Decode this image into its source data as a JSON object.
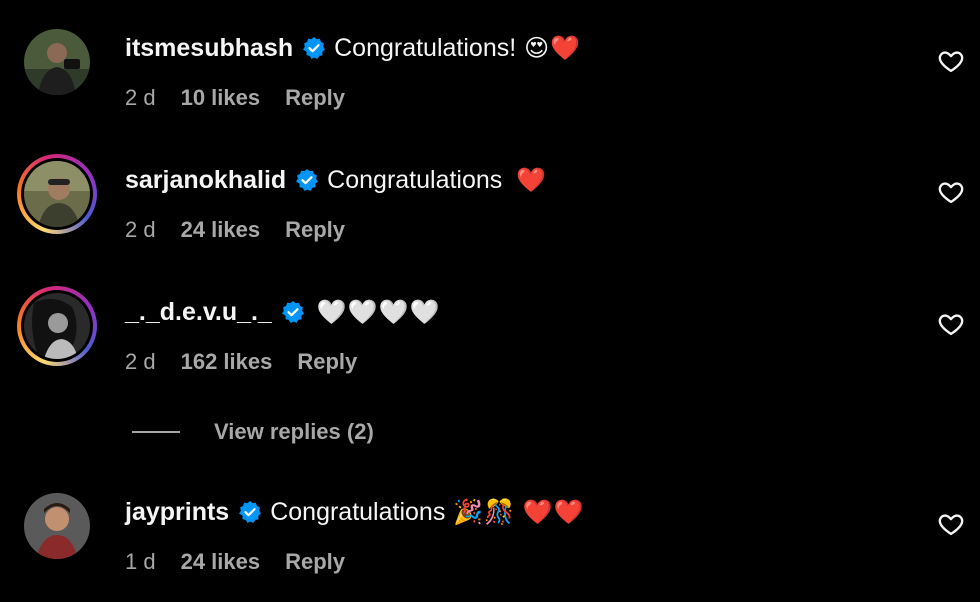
{
  "comments": [
    {
      "username": "itsmesubhash",
      "text": "Congratulations!",
      "emoji": "😍❤️",
      "age": "2 d",
      "likes": "10 likes",
      "reply": "Reply"
    },
    {
      "username": "sarjanokhalid",
      "text": "Congratulations",
      "emoji": "❤️",
      "age": "2 d",
      "likes": "24 likes",
      "reply": "Reply"
    },
    {
      "username": "_._d.e.v.u_._",
      "text": "",
      "emoji": "🤍🤍🤍🤍",
      "age": "2 d",
      "likes": "162 likes",
      "reply": "Reply",
      "view_replies": "View replies (2)"
    },
    {
      "username": "jayprints",
      "text": "Congratulations",
      "emoji": "🎉🎊 ❤️❤️",
      "age": "1 d",
      "likes": "24 likes",
      "reply": "Reply"
    }
  ],
  "colors": {
    "background": "#000000",
    "primary_text": "#f5f5f5",
    "secondary_text": "#a8a8a8",
    "verified": "#0095f6"
  },
  "icons": {
    "verified": "verified-badge-icon",
    "like": "heart-outline-icon"
  }
}
